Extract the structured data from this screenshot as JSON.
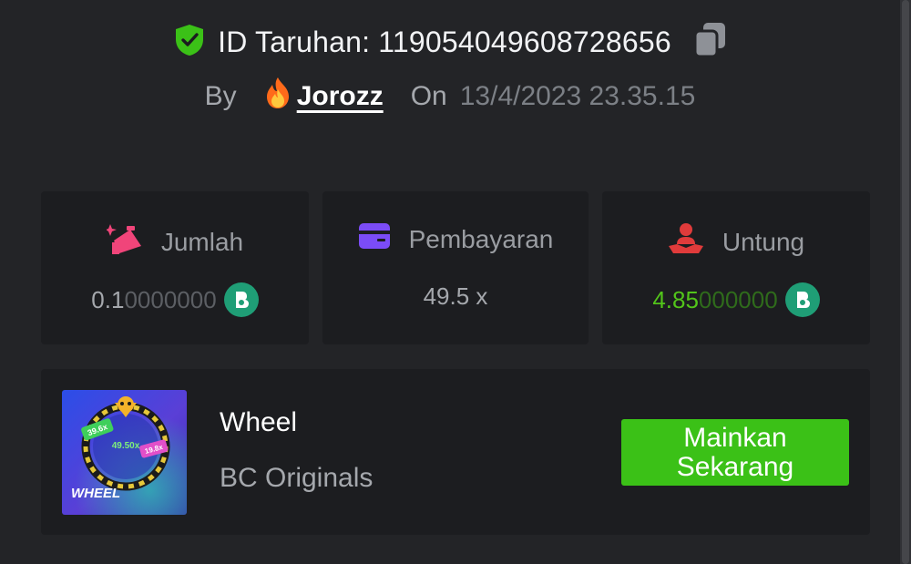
{
  "header": {
    "bet_id_label": "ID Taruhan: 119054049608728656",
    "by_label": "By",
    "username": "Jorozz",
    "on_label": "On",
    "date": "13/4/2023 23.35.15"
  },
  "stats": [
    {
      "label": "Jumlah",
      "value_bright": "0.1",
      "value_dim": "0000000",
      "icon": "bet-amount-icon"
    },
    {
      "label": "Pembayaran",
      "value": "49.5 x",
      "icon": "payment-card-icon"
    },
    {
      "label": "Untung",
      "value_bright": "4.85",
      "value_dim": "000000",
      "icon": "profit-hand-icon"
    }
  ],
  "game": {
    "name": "Wheel",
    "provider": "BC Originals",
    "play_label": "Mainkan Sekarang",
    "thumb": {
      "title": "WHEEL",
      "chip_left": "39.6x",
      "chip_center": "49.50x",
      "chip_right": "19.8x"
    }
  },
  "colors": {
    "background": "#232427",
    "card": "#1c1d20",
    "accent_green": "#3bc117",
    "profit_green": "#52c41a",
    "coin": "#1f9e76",
    "icon_pink": "#f0457a",
    "icon_purple": "#7b4cf6",
    "icon_red": "#e03b3b",
    "shield_green": "#3bc117"
  }
}
